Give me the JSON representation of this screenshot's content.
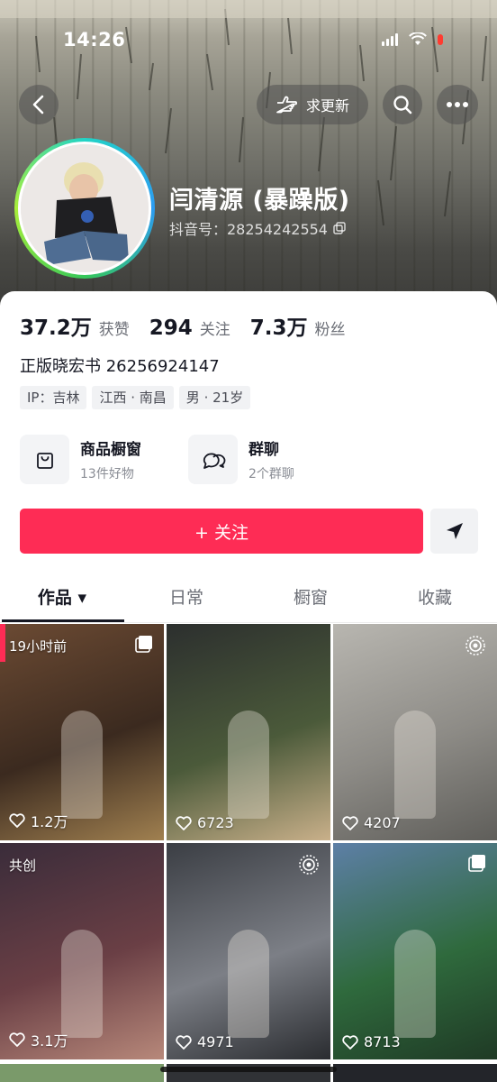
{
  "status_bar": {
    "time": "14:26"
  },
  "header": {
    "update_label": "求更新"
  },
  "profile": {
    "name": "闫清源 (暴躁版)",
    "douyin_id": "抖音号：28254242554",
    "stats": [
      {
        "value": "37.2万",
        "label": "获赞"
      },
      {
        "value": "294",
        "label": "关注"
      },
      {
        "value": "7.3万",
        "label": "粉丝"
      }
    ],
    "bio": "正版晓宏书 26256924147",
    "tags": [
      "IP：吉林",
      "江西 · 南昌",
      "男 · 21岁"
    ]
  },
  "services": [
    {
      "title": "商品橱窗",
      "subtitle": "13件好物",
      "icon": "bag-icon"
    },
    {
      "title": "群聊",
      "subtitle": "2个群聊",
      "icon": "chat-icon"
    }
  ],
  "actions": {
    "follow_label": "+ 关注"
  },
  "tabs": [
    "作品 ▾",
    "日常",
    "橱窗",
    "收藏"
  ],
  "videos": [
    {
      "likes": "1.2万",
      "badge": "19小时前",
      "corner": "multi-image-icon",
      "colors": [
        "#6b4a33",
        "#3b2a1f",
        "#a08050"
      ]
    },
    {
      "likes": "6723",
      "badge": "",
      "corner": "",
      "colors": [
        "#2c2f2e",
        "#4b5a3a",
        "#c9b08a"
      ]
    },
    {
      "likes": "4207",
      "badge": "",
      "corner": "live-photo-icon",
      "colors": [
        "#b8b6b0",
        "#8d8b86",
        "#5f5e5a"
      ]
    },
    {
      "likes": "3.1万",
      "badge": "共创",
      "corner": "",
      "colors": [
        "#3a2c3a",
        "#6a3f45",
        "#b7887a"
      ]
    },
    {
      "likes": "4971",
      "badge": "",
      "corner": "live-photo-icon",
      "colors": [
        "#3b3e44",
        "#7c7f86",
        "#2a2c30"
      ]
    },
    {
      "likes": "8713",
      "badge": "",
      "corner": "multi-image-icon",
      "colors": [
        "#5d7fa6",
        "#2f6a3d",
        "#1f3a25"
      ]
    }
  ]
}
